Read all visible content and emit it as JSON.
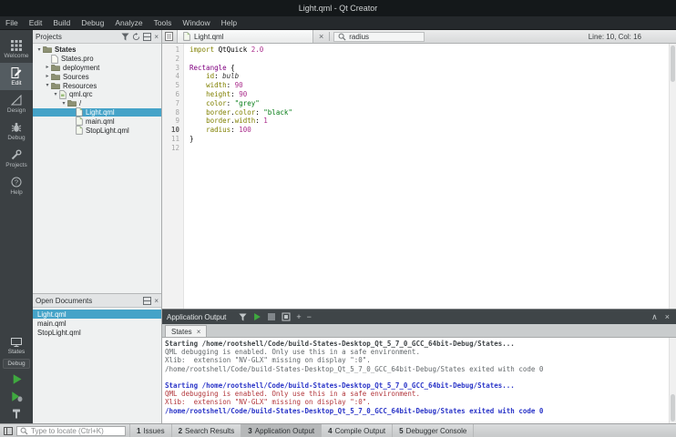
{
  "window": {
    "title": "Light.qml - Qt Creator"
  },
  "menubar": {
    "items": [
      "File",
      "Edit",
      "Build",
      "Debug",
      "Analyze",
      "Tools",
      "Window",
      "Help"
    ]
  },
  "modebar": {
    "modes": [
      {
        "label": "Welcome",
        "icon": "welcome-icon",
        "selected": false
      },
      {
        "label": "Edit",
        "icon": "edit-icon",
        "selected": true
      },
      {
        "label": "Design",
        "icon": "design-icon",
        "selected": false
      },
      {
        "label": "Debug",
        "icon": "debug-icon",
        "selected": false
      },
      {
        "label": "Projects",
        "icon": "projects-icon",
        "selected": false
      },
      {
        "label": "Help",
        "icon": "help-icon",
        "selected": false
      }
    ],
    "target": {
      "project": "States",
      "build_config": "Debug",
      "icon": "monitor-icon"
    },
    "actions": [
      {
        "name": "run-button",
        "icon": "run-icon"
      },
      {
        "name": "debug-run-button",
        "icon": "debug-run-icon"
      },
      {
        "name": "build-button",
        "icon": "hammer-icon"
      }
    ]
  },
  "projects_panel": {
    "title": "Projects",
    "header_icons": [
      "filter-icon",
      "sync-icon",
      "split-icon",
      "close-icon"
    ],
    "tree": [
      {
        "label": "States",
        "level": 0,
        "icon": "folder-icon",
        "expand": "open",
        "bold": true
      },
      {
        "label": "States.pro",
        "level": 1,
        "icon": "file-icon",
        "expand": "none"
      },
      {
        "label": "deployment",
        "level": 1,
        "icon": "folder-icon",
        "expand": "closed"
      },
      {
        "label": "Sources",
        "level": 1,
        "icon": "folder-icon",
        "expand": "closed"
      },
      {
        "label": "Resources",
        "level": 1,
        "icon": "folder-icon",
        "expand": "open"
      },
      {
        "label": "qml.qrc",
        "level": 2,
        "icon": "qrc-file-icon",
        "expand": "open"
      },
      {
        "label": "/",
        "level": 3,
        "icon": "folder-icon",
        "expand": "open"
      },
      {
        "label": "Light.qml",
        "level": 4,
        "icon": "qml-file-icon",
        "expand": "none",
        "selected": true
      },
      {
        "label": "main.qml",
        "level": 4,
        "icon": "qml-file-icon",
        "expand": "none"
      },
      {
        "label": "StopLight.qml",
        "level": 4,
        "icon": "qml-file-icon",
        "expand": "none"
      }
    ]
  },
  "open_documents_panel": {
    "title": "Open Documents",
    "header_icons": [
      "split-icon",
      "close-icon"
    ],
    "docs": [
      {
        "label": "Light.qml",
        "selected": true
      },
      {
        "label": "main.qml",
        "selected": false
      },
      {
        "label": "StopLight.qml",
        "selected": false
      }
    ]
  },
  "editor": {
    "tab_label": "Light.qml",
    "tab_icon": "qml-file-icon",
    "symbol": "radius",
    "symbol_icon": "search-icon",
    "cursor_position": "Line: 10, Col: 16",
    "language": "QML",
    "lines": [
      {
        "n": "1",
        "s": [
          [
            "kw",
            "import"
          ],
          [
            "pl",
            " QtQuick "
          ],
          [
            "num",
            "2.0"
          ]
        ]
      },
      {
        "n": "2",
        "s": []
      },
      {
        "n": "3",
        "s": [
          [
            "type",
            "Rectangle"
          ],
          [
            "pl",
            " {"
          ]
        ]
      },
      {
        "n": "4",
        "s": [
          [
            "pl",
            "    "
          ],
          [
            "prop",
            "id"
          ],
          [
            "pl",
            ": "
          ],
          [
            "idv",
            "bulb"
          ]
        ]
      },
      {
        "n": "5",
        "s": [
          [
            "pl",
            "    "
          ],
          [
            "prop",
            "width"
          ],
          [
            "pl",
            ": "
          ],
          [
            "num",
            "90"
          ]
        ]
      },
      {
        "n": "6",
        "s": [
          [
            "pl",
            "    "
          ],
          [
            "prop",
            "height"
          ],
          [
            "pl",
            ": "
          ],
          [
            "num",
            "90"
          ]
        ]
      },
      {
        "n": "7",
        "s": [
          [
            "pl",
            "    "
          ],
          [
            "prop",
            "color"
          ],
          [
            "pl",
            ": "
          ],
          [
            "str",
            "\"grey\""
          ]
        ]
      },
      {
        "n": "8",
        "s": [
          [
            "pl",
            "    "
          ],
          [
            "prop",
            "border"
          ],
          [
            "pl",
            "."
          ],
          [
            "prop",
            "color"
          ],
          [
            "pl",
            ": "
          ],
          [
            "str",
            "\"black\""
          ]
        ]
      },
      {
        "n": "9",
        "s": [
          [
            "pl",
            "    "
          ],
          [
            "prop",
            "border"
          ],
          [
            "pl",
            "."
          ],
          [
            "prop",
            "width"
          ],
          [
            "pl",
            ": "
          ],
          [
            "num",
            "1"
          ]
        ]
      },
      {
        "n": "10",
        "s": [
          [
            "pl",
            "    "
          ],
          [
            "prop",
            "radius"
          ],
          [
            "pl",
            ": "
          ],
          [
            "num",
            "100"
          ]
        ],
        "current": true
      },
      {
        "n": "11",
        "s": [
          [
            "pl",
            "}"
          ]
        ]
      },
      {
        "n": "12",
        "s": []
      }
    ]
  },
  "output_panel": {
    "title": "Application Output",
    "tab": "States",
    "toolbar_icons": [
      "filter-icon",
      "rerun-icon",
      "stop-icon",
      "attach-icon",
      "zoom-in-icon",
      "zoom-out-icon"
    ],
    "window_icons": [
      "minimize-icon",
      "close-icon"
    ],
    "lines": [
      {
        "text": "Starting /home/rootshell/Code/build-States-Desktop_Qt_5_7_0_GCC_64bit-Debug/States...",
        "style": "gray-bold"
      },
      {
        "text": "QML debugging is enabled. Only use this in a safe environment.",
        "style": "gray"
      },
      {
        "text": "Xlib:  extension \"NV-GLX\" missing on display \":0\".",
        "style": "gray"
      },
      {
        "text": "/home/rootshell/Code/build-States-Desktop_Qt_5_7_0_GCC_64bit-Debug/States exited with code 0",
        "style": "gray"
      },
      {
        "text": "",
        "style": "gray"
      },
      {
        "text": "Starting /home/rootshell/Code/build-States-Desktop_Qt_5_7_0_GCC_64bit-Debug/States...",
        "style": "blue-bold"
      },
      {
        "text": "QML debugging is enabled. Only use this in a safe environment.",
        "style": "red"
      },
      {
        "text": "Xlib:  extension \"NV-GLX\" missing on display \":0\".",
        "style": "red"
      },
      {
        "text": "/home/rootshell/Code/build-States-Desktop_Qt_5_7_0_GCC_64bit-Debug/States exited with code 0",
        "style": "blue-bold"
      }
    ]
  },
  "statusbar": {
    "toggle_icon": "sidebar-toggle-icon",
    "locator_icon": "search-icon",
    "locator_placeholder": "Type to locate (Ctrl+K)",
    "panes": [
      {
        "index": "1",
        "label": "Issues",
        "active": false
      },
      {
        "index": "2",
        "label": "Search Results",
        "active": false
      },
      {
        "index": "3",
        "label": "Application Output",
        "active": true
      },
      {
        "index": "4",
        "label": "Compile Output",
        "active": false
      },
      {
        "index": "5",
        "label": "Debugger Console",
        "active": false
      }
    ]
  },
  "colors": {
    "selection_blue": "#45a3c8",
    "run_green": "#3fa93f",
    "keyword": "#808000",
    "type": "#800080",
    "number": "#ab2f8d",
    "string": "#067d17",
    "output_blue": "#2a35c8",
    "output_red": "#b2373c"
  }
}
